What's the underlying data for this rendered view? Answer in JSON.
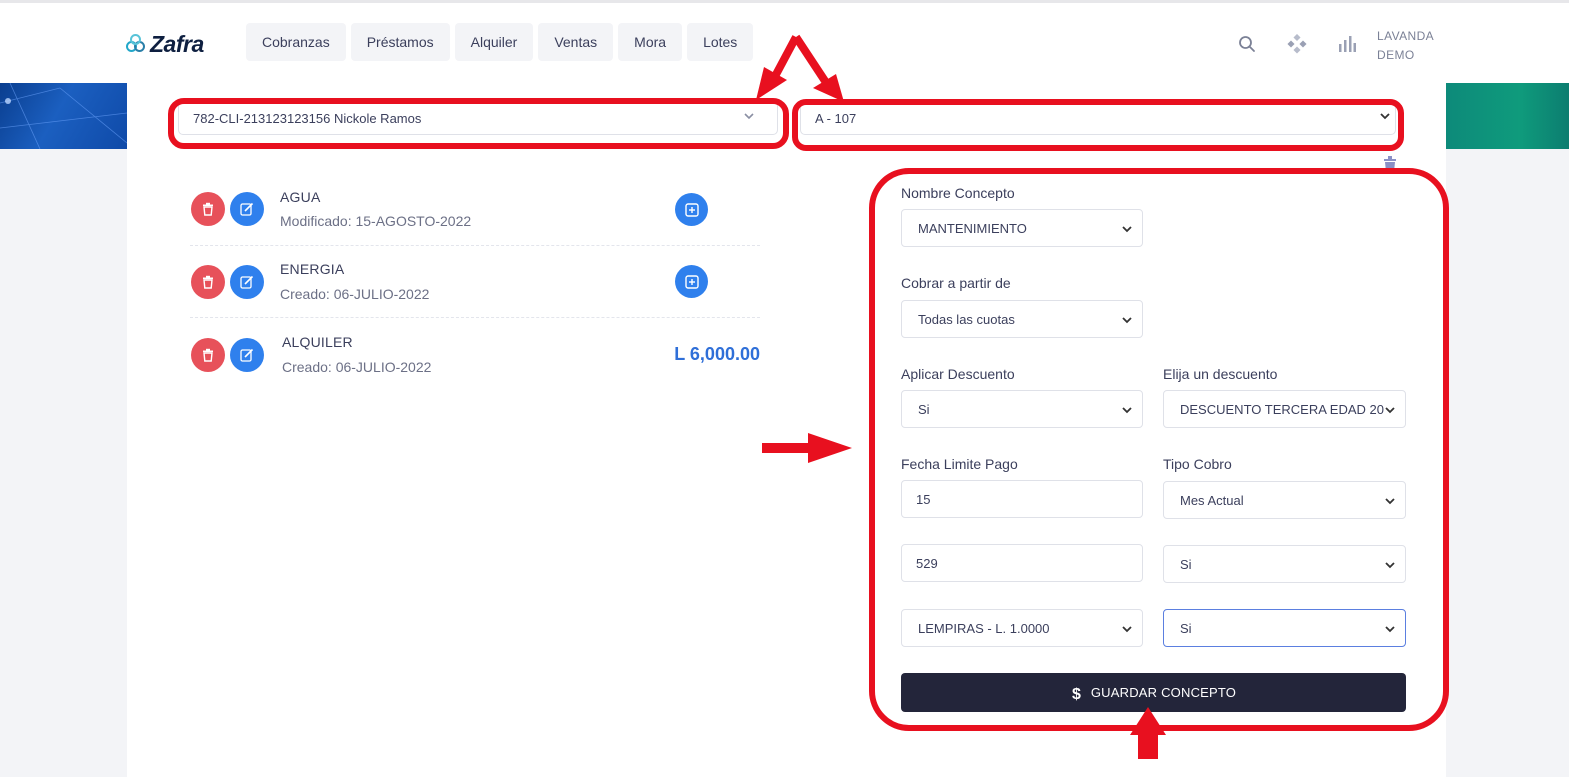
{
  "brand": {
    "name": "Zafra"
  },
  "nav": {
    "tabs": [
      {
        "label": "Cobranzas"
      },
      {
        "label": "Préstamos"
      },
      {
        "label": "Alquiler"
      },
      {
        "label": "Ventas"
      },
      {
        "label": "Mora"
      },
      {
        "label": "Lotes"
      }
    ]
  },
  "header": {
    "icons": [
      "search-icon",
      "apps-diamond-icon",
      "bar-chart-icon"
    ],
    "user_line1": "LAVANDA",
    "user_line2": "DEMO"
  },
  "selectors": {
    "client": "782-CLI-213123123156 Nickole Ramos",
    "unit": "A - 107"
  },
  "concepts": [
    {
      "title": "AGUA",
      "subtitle": "Modificado: 15-AGOSTO-2022",
      "amount": ""
    },
    {
      "title": "ENERGIA",
      "subtitle": "Creado: 06-JULIO-2022",
      "amount": ""
    },
    {
      "title": "ALQUILER",
      "subtitle": "Creado: 06-JULIO-2022",
      "amount": "L 6,000.00"
    }
  ],
  "form": {
    "concept_label": "Nombre Concepto",
    "concept_value": "MANTENIMIENTO",
    "from_label": "Cobrar a partir de",
    "from_value": "Todas las cuotas",
    "discount_label": "Aplicar Descuento",
    "discount_value": "Si",
    "choose_discount_label": "Elija un descuento",
    "choose_discount_value": "DESCUENTO TERCERA EDAD 20",
    "due_label": "Fecha Limite Pago",
    "due_value": "15",
    "type_label": "Tipo Cobro",
    "type_value": "Mes Actual",
    "amount_value": "529",
    "flag1_value": "Si",
    "currency_value": "LEMPIRAS - L. 1.0000",
    "flag2_value": "Si",
    "save_label": "GUARDAR CONCEPTO"
  },
  "colors": {
    "accent": "#2f80ed",
    "danger": "#e7515a",
    "amount": "#2f6fd8",
    "dark_button": "#23253a",
    "annotation": "#e8101f"
  }
}
